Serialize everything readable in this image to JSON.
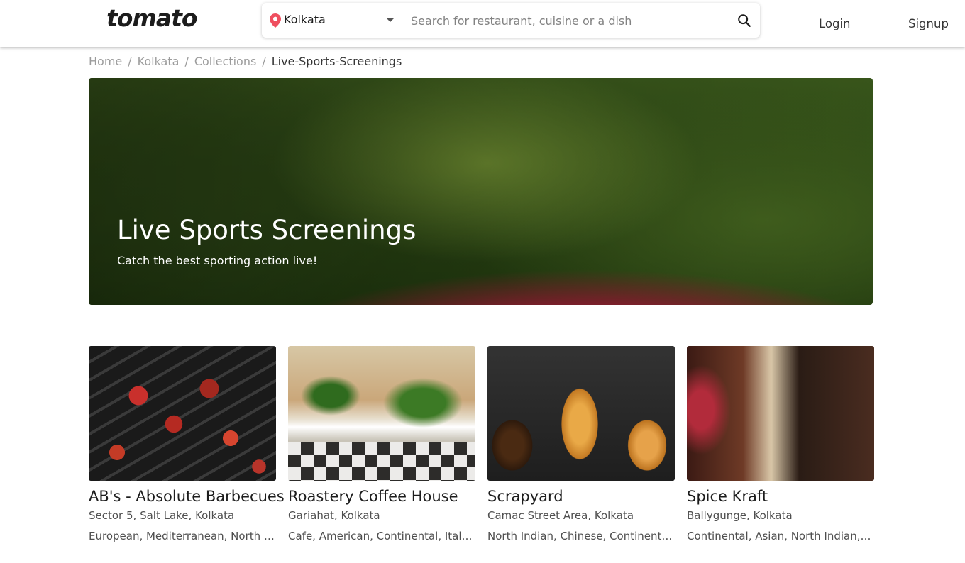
{
  "header": {
    "logo": "tomato",
    "location": "Kolkata",
    "search_placeholder": "Search for restaurant, cuisine or a dish",
    "login": "Login",
    "signup": "Signup"
  },
  "breadcrumb": {
    "items": [
      "Home",
      "Kolkata",
      "Collections"
    ],
    "separator": "/",
    "current": "Live-Sports-Screenings"
  },
  "hero": {
    "title": "Live Sports Screenings",
    "subtitle": "Catch the best sporting action live!"
  },
  "restaurants": [
    {
      "name": "AB's - Absolute Barbecues",
      "location": "Sector 5, Salt Lake, Kolkata",
      "cuisine": "European, Mediterranean, North Indian"
    },
    {
      "name": "Roastery Coffee House",
      "location": "Gariahat, Kolkata",
      "cuisine": "Cafe, American, Continental, Italian"
    },
    {
      "name": "Scrapyard",
      "location": "Camac Street Area, Kolkata",
      "cuisine": "North Indian, Chinese, Continental, Italian"
    },
    {
      "name": "Spice Kraft",
      "location": "Ballygunge, Kolkata",
      "cuisine": "Continental, Asian, North Indian, Mughlai"
    }
  ],
  "icons": {
    "location": "location-pin-icon",
    "dropdown": "caret-down-icon",
    "search": "search-icon"
  },
  "colors": {
    "pin": "#ef4f5f",
    "text_primary": "#1c1c1c",
    "text_secondary": "#4f4f4f",
    "breadcrumb": "#9c9c9c"
  }
}
